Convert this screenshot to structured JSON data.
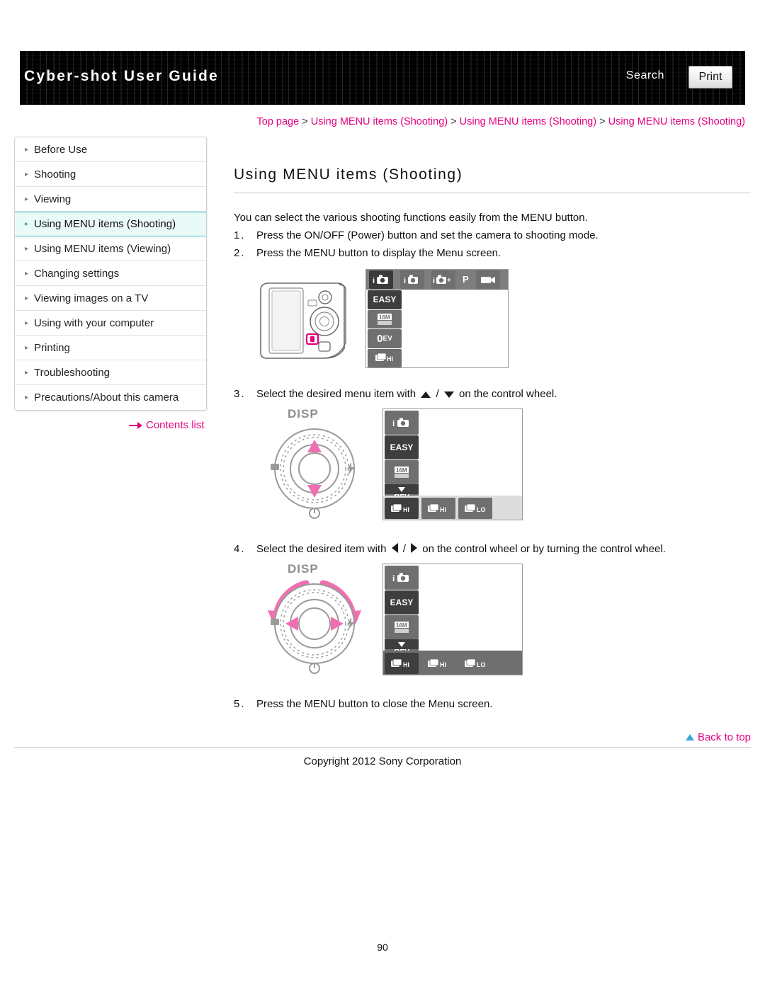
{
  "header": {
    "title": "Cyber-shot User Guide",
    "search_label": "Search",
    "print_label": "Print"
  },
  "breadcrumb": {
    "items": [
      "Top page",
      "Using MENU items (Shooting)",
      "Using MENU items (Shooting)",
      "Using MENU items (Shooting)"
    ],
    "separator": ">"
  },
  "sidebar": {
    "items": [
      {
        "label": "Before Use",
        "selected": false
      },
      {
        "label": "Shooting",
        "selected": false
      },
      {
        "label": "Viewing",
        "selected": false
      },
      {
        "label": "Using MENU items (Shooting)",
        "selected": true
      },
      {
        "label": "Using MENU items (Viewing)",
        "selected": false
      },
      {
        "label": "Changing settings",
        "selected": false
      },
      {
        "label": "Viewing images on a TV",
        "selected": false
      },
      {
        "label": "Using with your computer",
        "selected": false
      },
      {
        "label": "Printing",
        "selected": false
      },
      {
        "label": "Troubleshooting",
        "selected": false
      },
      {
        "label": "Precautions/About this camera",
        "selected": false
      }
    ],
    "contents_list_label": "Contents list"
  },
  "main": {
    "title": "Using MENU items (Shooting)",
    "intro": "You can select the various shooting functions easily from the MENU button.",
    "steps": [
      {
        "num": "1.",
        "text": "Press the ON/OFF (Power) button and set the camera to shooting mode."
      },
      {
        "num": "2.",
        "text": "Press the MENU button to display the Menu screen."
      },
      {
        "num": "3.",
        "text_before": "Select the desired menu item with",
        "text_after": "on the control wheel."
      },
      {
        "num": "4.",
        "text_before": "Select the desired item with",
        "text_after": "on the control wheel or by turning the control wheel."
      },
      {
        "num": "5.",
        "text": "Press the MENU button to close the Menu screen."
      }
    ]
  },
  "figures": {
    "menu_top_icons": [
      "i-camera",
      "i-camera",
      "i-camera-plus",
      "P",
      "movie"
    ],
    "menu_column": [
      "EASY",
      "image-size-16M",
      "0EV",
      "burst-HI"
    ],
    "menu_row_items": [
      "burst-HI",
      "burst-HI",
      "burst-LO"
    ],
    "disp_label": "DISP",
    "labels": {
      "easy": "EASY",
      "ev": "0",
      "ev_unit": "EV",
      "program": "P",
      "image_size": "16M",
      "burst_hi": "HI",
      "burst_lo": "LO"
    }
  },
  "footer": {
    "back_to_top": "Back to top",
    "copyright": "Copyright 2012 Sony Corporation",
    "page_number": "90"
  }
}
